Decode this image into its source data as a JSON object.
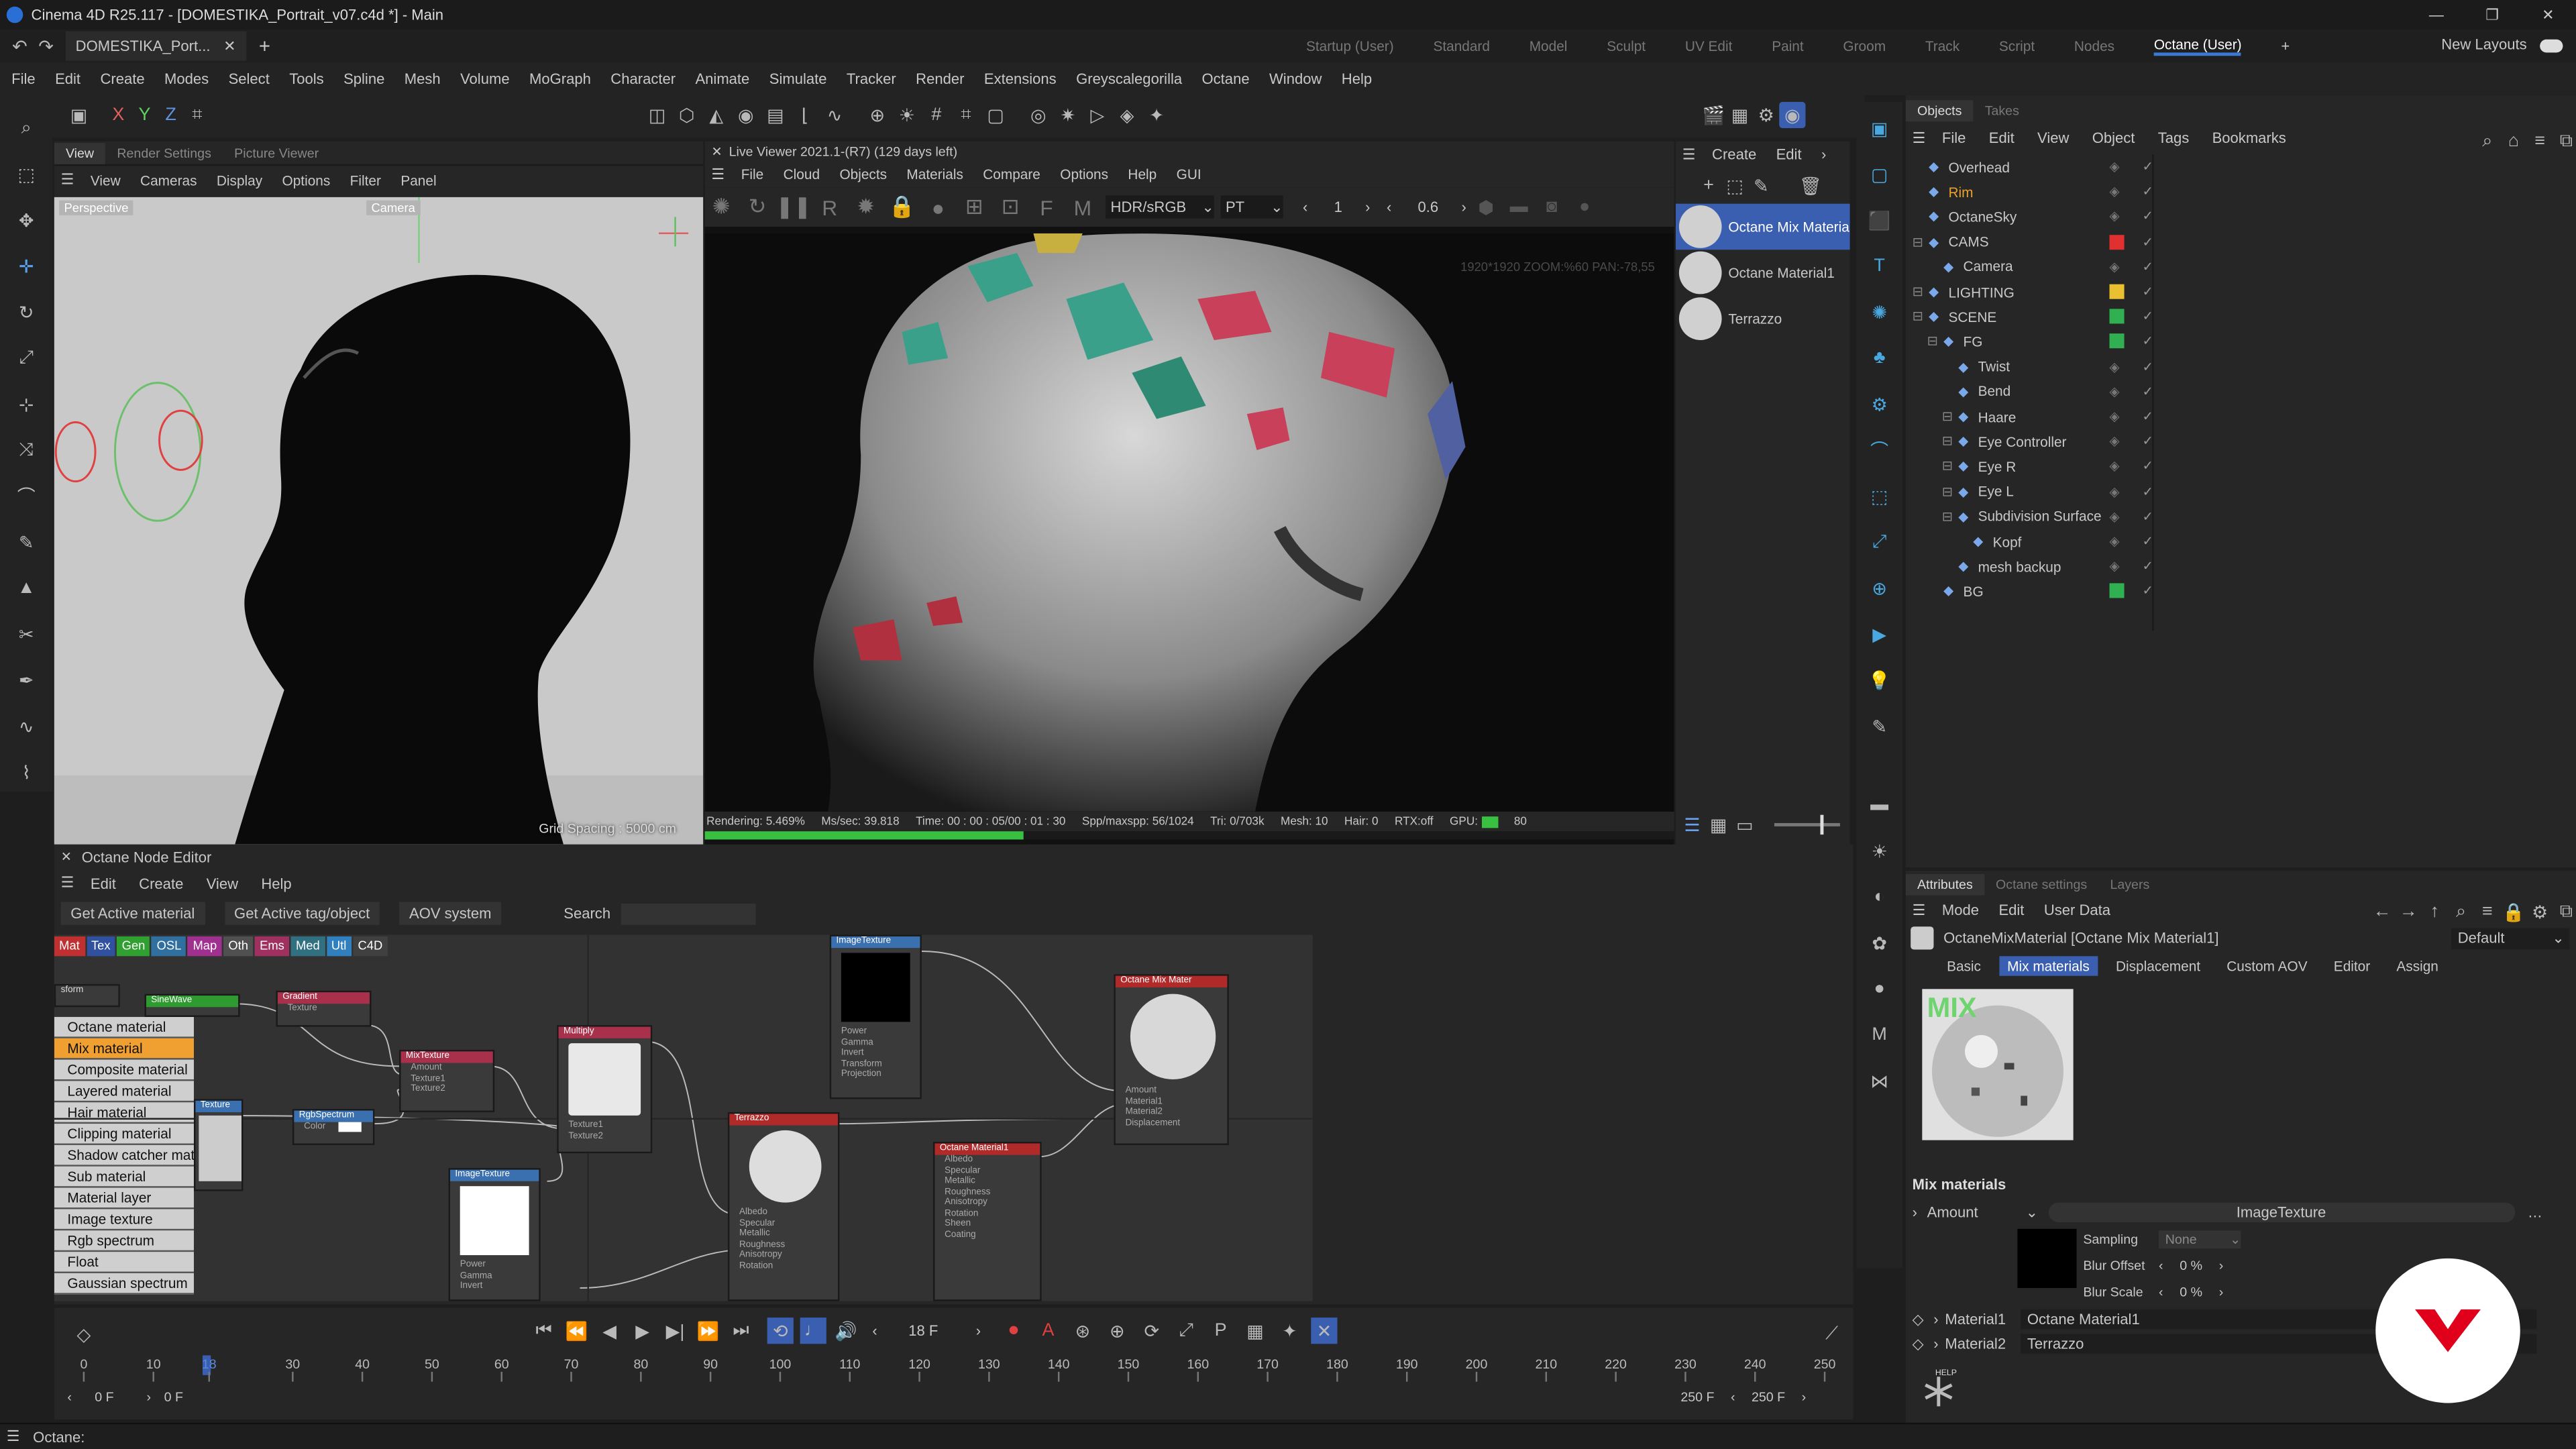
{
  "window": {
    "title": "Cinema 4D R25.117 - [DOMESTIKA_Portrait_v07.c4d *] - Main",
    "doc_tab": "DOMESTIKA_Port...",
    "icon": "c4d-icon"
  },
  "layouts": {
    "items": [
      "Startup (User)",
      "Standard",
      "Model",
      "Sculpt",
      "UV Edit",
      "Paint",
      "Groom",
      "Track",
      "Script",
      "Nodes",
      "Octane (User)"
    ],
    "active": "Octane (User)",
    "new_layouts": "New Layouts"
  },
  "menu": [
    "File",
    "Edit",
    "Create",
    "Modes",
    "Select",
    "Tools",
    "Spline",
    "Mesh",
    "Volume",
    "MoGraph",
    "Character",
    "Animate",
    "Simulate",
    "Tracker",
    "Render",
    "Extensions",
    "Greyscalegorilla",
    "Octane",
    "Window",
    "Help"
  ],
  "viewport_left": {
    "tabs": [
      "View",
      "Render Settings",
      "Picture Viewer"
    ],
    "menu": [
      "View",
      "Cameras",
      "Display",
      "Options",
      "Filter",
      "Panel"
    ],
    "label": "Perspective",
    "camera": "Camera",
    "grid": "Grid Spacing : 5000 cm"
  },
  "live_viewer": {
    "title": "Live Viewer 2021.1-(R7) (129 days left)",
    "menu": [
      "File",
      "Cloud",
      "Objects",
      "Materials",
      "Compare",
      "Options",
      "Help",
      "GUI"
    ],
    "hdr": "HDR/sRGB",
    "mode": "PT",
    "value1": "1",
    "value2": "0.6",
    "info": "1920*1920 ZOOM:%60 PAN:-78,55"
  },
  "status_bar": {
    "rendering": "Rendering: 5.469%",
    "ms": "Ms/sec: 39.818",
    "time": "Time: 00 : 00 : 05/00 : 01 : 30",
    "spp": "Spp/maxspp: 56/1024",
    "tri": "Tri: 0/703k",
    "mesh": "Mesh: 10",
    "hair": "Hair: 0",
    "rtx": "RTX:off",
    "gpu": "GPU:",
    "gpu_val": "80"
  },
  "materials_panel": {
    "menu": [
      "Create",
      "Edit"
    ],
    "items": [
      "Octane Mix Materia",
      "Octane Material1",
      "Terrazzo"
    ]
  },
  "objects": {
    "tabs": [
      "Objects",
      "Takes"
    ],
    "menu": [
      "File",
      "Edit",
      "View",
      "Object",
      "Tags",
      "Bookmarks"
    ],
    "items": [
      {
        "name": "Overhead",
        "indent": 0,
        "color": "#c8c8c8"
      },
      {
        "name": "Rim",
        "indent": 0,
        "color": "#e8a030"
      },
      {
        "name": "OctaneSky",
        "indent": 0,
        "color": "#c8c8c8"
      },
      {
        "name": "CAMS",
        "indent": 0,
        "color": "#c8c8c8",
        "dot": "#e03030"
      },
      {
        "name": "Camera",
        "indent": 1,
        "color": "#c8c8c8"
      },
      {
        "name": "LIGHTING",
        "indent": 0,
        "color": "#c8c8c8",
        "dot": "#e8c030"
      },
      {
        "name": "SCENE",
        "indent": 0,
        "color": "#c8c8c8",
        "dot": "#30b050"
      },
      {
        "name": "FG",
        "indent": 1,
        "color": "#c8c8c8",
        "dot": "#30b050"
      },
      {
        "name": "Twist",
        "indent": 2,
        "color": "#c8c8c8"
      },
      {
        "name": "Bend",
        "indent": 2,
        "color": "#c8c8c8"
      },
      {
        "name": "Haare",
        "indent": 2,
        "color": "#c8c8c8"
      },
      {
        "name": "Eye Controller",
        "indent": 2,
        "color": "#c8c8c8"
      },
      {
        "name": "Eye R",
        "indent": 2,
        "color": "#c8c8c8"
      },
      {
        "name": "Eye L",
        "indent": 2,
        "color": "#c8c8c8"
      },
      {
        "name": "Subdivision Surface",
        "indent": 2,
        "color": "#c8c8c8"
      },
      {
        "name": "Kopf",
        "indent": 3,
        "color": "#c8c8c8"
      },
      {
        "name": "mesh backup",
        "indent": 2,
        "color": "#c8c8c8"
      },
      {
        "name": "BG",
        "indent": 1,
        "color": "#c8c8c8",
        "dot": "#30b050"
      }
    ]
  },
  "node_editor": {
    "title": "Octane Node Editor",
    "menu": [
      "Edit",
      "Create",
      "View",
      "Help"
    ],
    "buttons": [
      "Get Active material",
      "Get Active tag/object",
      "AOV system"
    ],
    "search_label": "Search",
    "filters": [
      {
        "t": "Mat",
        "c": "#c03030"
      },
      {
        "t": "Tex",
        "c": "#3050a0"
      },
      {
        "t": "Gen",
        "c": "#30a030"
      },
      {
        "t": "OSL",
        "c": "#3070a0"
      },
      {
        "t": "Map",
        "c": "#a03090"
      },
      {
        "t": "Oth",
        "c": "#505050"
      },
      {
        "t": "Ems",
        "c": "#a03060"
      },
      {
        "t": "Med",
        "c": "#307080"
      },
      {
        "t": "Utl",
        "c": "#3080c0"
      },
      {
        "t": "C4D",
        "c": "#404040"
      }
    ],
    "material_list": [
      "Octane material",
      "Mix material",
      "Composite material",
      "Layered material",
      "Hair material",
      "Clipping material",
      "Shadow catcher mat",
      "Sub material",
      "Material layer",
      "Image texture",
      "Rgb spectrum",
      "Float",
      "Gaussian spectrum"
    ],
    "nodes": {
      "gradient": "Gradient",
      "mixtexture": "MixTexture",
      "multiply": "Multiply",
      "rgbspectrum": "RgbSpectrum",
      "imagetexture": "ImageTexture",
      "imagetexture2": "ImageTexture",
      "terrazzo": "Terrazzo",
      "octmat": "Octane Material1",
      "mixmat": "Octane Mix Mater",
      "sinewave": "SineWave",
      "texture": "Texture",
      "texture_port": "Texture",
      "amount": "Amount",
      "material1": "Material1",
      "material2": "Material2",
      "displacement": "Displacement",
      "color": "Color",
      "power": "Power",
      "gamma": "Gamma",
      "invert": "Invert",
      "transform": "Transform",
      "projection": "Projection",
      "texture1": "Texture1",
      "texture2": "Texture2",
      "albedo": "Albedo",
      "specular": "Specular",
      "metallic": "Metallic",
      "roughness": "Roughness",
      "anisotropy": "Anisotropy",
      "rotation": "Rotation",
      "sheen": "Sheen",
      "coating": "Coating",
      "form": "sform"
    }
  },
  "timeline": {
    "frame": "18 F",
    "ticks": [
      "0",
      "10",
      "18",
      "30",
      "40",
      "50",
      "60",
      "70",
      "80",
      "90",
      "100",
      "110",
      "120",
      "130",
      "140",
      "150",
      "160",
      "170",
      "180",
      "190",
      "200",
      "210",
      "220",
      "230",
      "240",
      "250"
    ],
    "start": "0 F",
    "start2": "0 F",
    "end": "250 F",
    "end2": "250 F"
  },
  "attributes": {
    "tabs": [
      "Attributes",
      "Octane settings",
      "Layers"
    ],
    "menu": [
      "Mode",
      "Edit",
      "User Data"
    ],
    "object": "OctaneMixMaterial [Octane Mix Material1]",
    "preset": "Default",
    "subtabs": [
      "Basic",
      "Mix materials",
      "Displacement",
      "Custom AOV",
      "Editor",
      "Assign"
    ],
    "active_subtab": "Mix materials",
    "preview_label": "MIX",
    "section": "Mix materials",
    "amount_label": "Amount",
    "amount_value": "ImageTexture",
    "sampling_label": "Sampling",
    "sampling_value": "None",
    "blur_offset_label": "Blur Offset",
    "blur_offset_value": "0 %",
    "blur_scale_label": "Blur Scale",
    "blur_scale_value": "0 %",
    "mat1_label": "Material1",
    "mat1_value": "Octane Material1",
    "mat2_label": "Material2",
    "mat2_value": "Terrazzo",
    "help": "HELP"
  },
  "bottom_status": "Octane:",
  "logo": "domestika-logo"
}
